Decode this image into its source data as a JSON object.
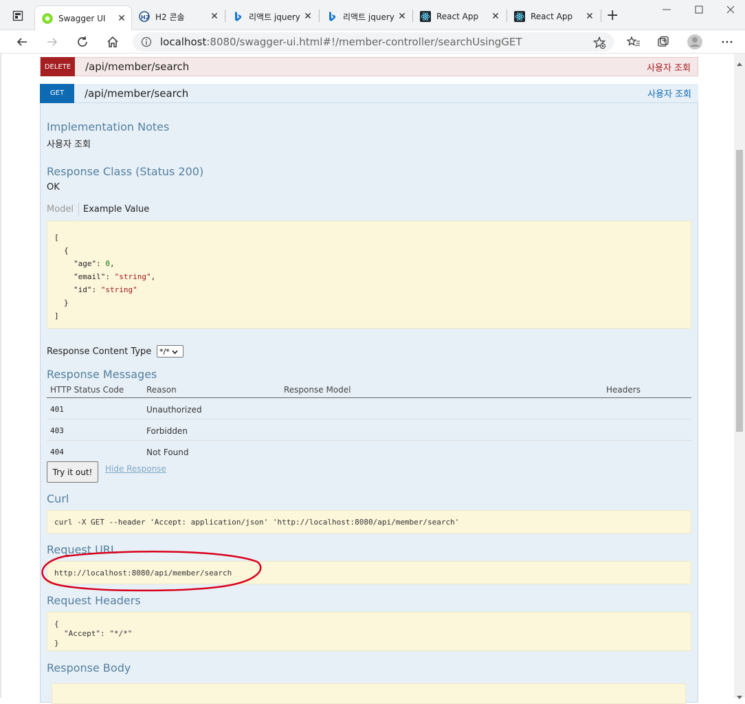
{
  "browser": {
    "tabs": [
      {
        "title": "Swagger UI",
        "icon": "swagger-icon"
      },
      {
        "title": "H2 콘솔",
        "icon": "h2-icon"
      },
      {
        "title": "리액트 jquery",
        "icon": "bing-icon"
      },
      {
        "title": "리액트 jquery",
        "icon": "bing-icon"
      },
      {
        "title": "React App",
        "icon": "react-icon"
      },
      {
        "title": "React App",
        "icon": "react-icon"
      }
    ],
    "new_tab": "+",
    "url_host": "localhost",
    "url_rest": ":8080/swagger-ui.html#!/member-controller/searchUsingGET"
  },
  "ops": {
    "delete": {
      "method": "DELETE",
      "path": "/api/member/search",
      "summary": "사용자 조회"
    },
    "get": {
      "method": "GET",
      "path": "/api/member/search",
      "summary": "사용자 조회"
    }
  },
  "details": {
    "impl_title": "Implementation Notes",
    "impl_text": "사용자 조회",
    "resp_class_title": "Response Class (Status 200)",
    "resp_class_text": "OK",
    "model_tab": "Model",
    "example_tab": "Example Value",
    "example_lines": {
      "open_bracket": "[",
      "open_brace": "{",
      "age_key": "\"age\"",
      "age_val": "0",
      "email_key": "\"email\"",
      "email_val": "\"string\"",
      "id_key": "\"id\"",
      "id_val": "\"string\"",
      "close_brace": "}",
      "close_bracket": "]"
    },
    "content_type_label": "Response Content Type",
    "content_type_value": "*/*",
    "resp_msgs_title": "Response Messages",
    "columns": [
      "HTTP Status Code",
      "Reason",
      "Response Model",
      "Headers"
    ],
    "rows": [
      {
        "code": "401",
        "reason": "Unauthorized"
      },
      {
        "code": "403",
        "reason": "Forbidden"
      },
      {
        "code": "404",
        "reason": "Not Found"
      }
    ],
    "try_button": "Try it out!",
    "hide_response": "Hide Response",
    "curl_title": "Curl",
    "curl_cmd": "curl -X GET --header 'Accept: application/json' 'http://localhost:8080/api/member/search'",
    "request_url_title": "Request URL",
    "request_url": "http://localhost:8080/api/member/search",
    "request_headers_title": "Request Headers",
    "request_headers": {
      "open": "{",
      "line": "\"Accept\": \"*/*\"",
      "close": "}"
    },
    "response_body_title": "Response Body"
  },
  "colors": {
    "delete_method": "#a41e22",
    "delete_bg": "#f5e8e8",
    "get_method": "#0f6ab4",
    "get_bg": "#e7f0f7",
    "link": "#547f9f",
    "annotation": "#d9001b"
  }
}
